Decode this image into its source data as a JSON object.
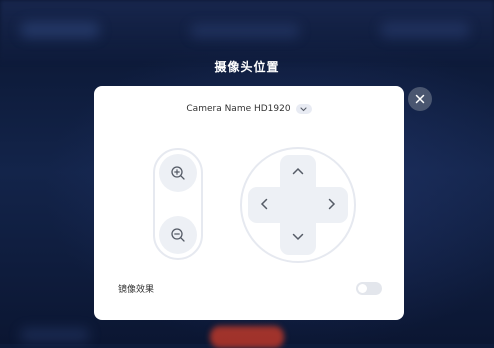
{
  "dialog": {
    "title": "摄像头位置",
    "camera_name": "Camera Name HD1920",
    "mirror_label": "镜像效果",
    "mirror_enabled": false
  },
  "icons": {
    "close": "close-icon",
    "camera_dropdown": "chevron-down-icon",
    "zoom_in": "zoom-in-icon",
    "zoom_out": "zoom-out-icon",
    "pan_up": "chevron-up-icon",
    "pan_down": "chevron-down-icon",
    "pan_left": "chevron-left-icon",
    "pan_right": "chevron-right-icon"
  },
  "colors": {
    "overlay_bg": "#0d1b3a",
    "panel_bg": "#ffffff",
    "control_bg": "#edf0f5",
    "icon": "#555b66",
    "close_bg": "#4a5670"
  }
}
